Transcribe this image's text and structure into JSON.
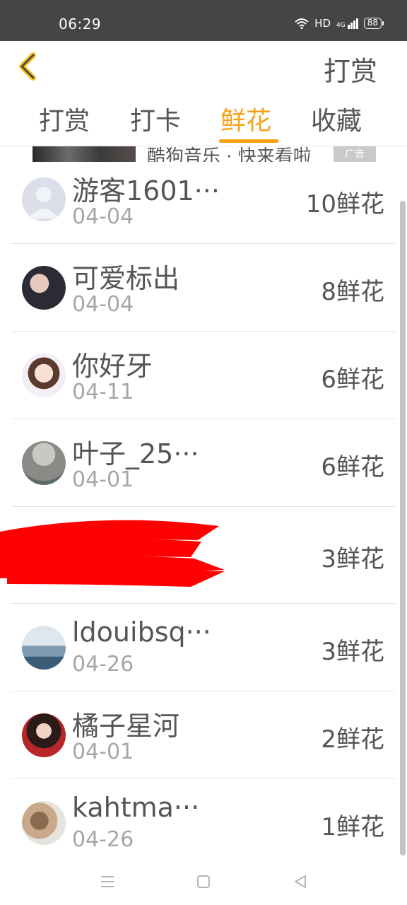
{
  "status_bar": {
    "time": "06:29",
    "network": "HD",
    "signal_label": "4G",
    "battery": "88"
  },
  "header": {
    "title": "打赏",
    "back_icon": "chevron-left-icon"
  },
  "tabs": [
    {
      "label": "打赏",
      "active": false
    },
    {
      "label": "打卡",
      "active": false
    },
    {
      "label": "鲜花",
      "active": true
    },
    {
      "label": "收藏",
      "active": false
    }
  ],
  "ad": {
    "text": "酷狗音乐 · 快来看啦",
    "tag": "广告"
  },
  "list": [
    {
      "name": "游客1601···",
      "date": "04-04",
      "amount": "10鲜花"
    },
    {
      "name": "可爱标出",
      "date": "04-04",
      "amount": "8鲜花"
    },
    {
      "name": "你好牙",
      "date": "04-11",
      "amount": "6鲜花"
    },
    {
      "name": "叶子_25···",
      "date": "04-01",
      "amount": "6鲜花"
    },
    {
      "name": "",
      "date": "",
      "amount": "3鲜花"
    },
    {
      "name": "ldouibsq···",
      "date": "04-26",
      "amount": "3鲜花"
    },
    {
      "name": "橘子星河",
      "date": "04-01",
      "amount": "2鲜花"
    },
    {
      "name": "kahtma···",
      "date": "04-26",
      "amount": "1鲜花"
    }
  ],
  "colors": {
    "accent": "#f7a21b",
    "status_bar": "#454545",
    "redaction": "#ff0000"
  }
}
